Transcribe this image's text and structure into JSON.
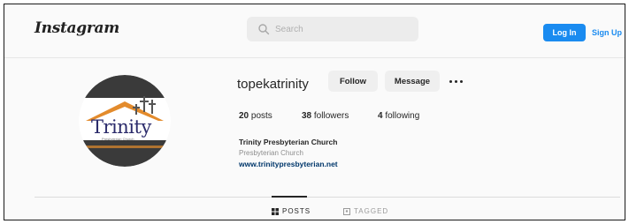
{
  "header": {
    "logo": "Instagram",
    "search_placeholder": "Search",
    "login_label": "Log In",
    "signup_label": "Sign Up"
  },
  "profile": {
    "username": "topekatrinity",
    "follow_label": "Follow",
    "message_label": "Message",
    "avatar_text": "Trinity",
    "avatar_subtext": "Presbyterian Church",
    "stats": {
      "posts_count": "20",
      "posts_label": "posts",
      "followers_count": "38",
      "followers_label": "followers",
      "following_count": "4",
      "following_label": "following"
    },
    "full_name": "Trinity Presbyterian Church",
    "category": "Presbyterian Church",
    "website": "www.trinitypresbyterian.net"
  },
  "tabs": {
    "posts_label": "POSTS",
    "tagged_label": "TAGGED"
  },
  "colors": {
    "accent": "#1a8bf0",
    "avatar_orange": "#e38b2c",
    "avatar_dark": "#3a3a3a"
  }
}
